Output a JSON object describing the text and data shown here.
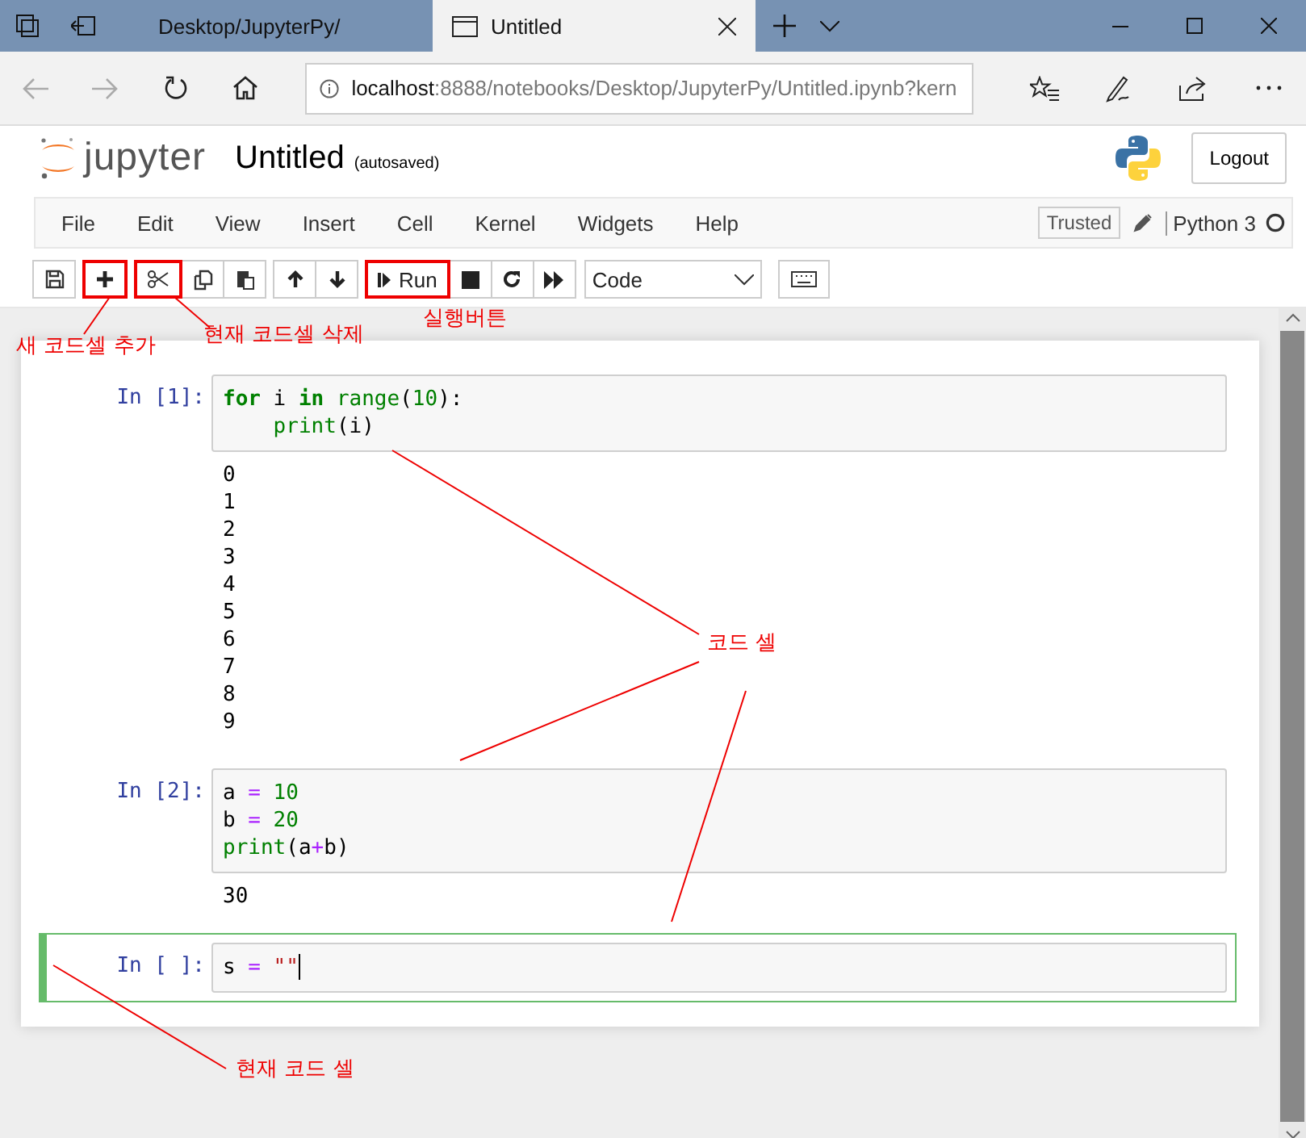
{
  "browser": {
    "tabs": [
      {
        "title": "Desktop/JupyterPy/",
        "selected": false
      },
      {
        "title": "Untitled",
        "selected": true
      }
    ],
    "nav": {
      "back_enabled": false,
      "forward_enabled": false
    },
    "address": {
      "host": "localhost",
      "path": ":8888/notebooks/Desktop/JupyterPy/Untitled.ipynb?kern"
    }
  },
  "header": {
    "logo_text": "jupyter",
    "title": "Untitled",
    "save_status": "(autosaved)",
    "logout": "Logout"
  },
  "menubar": {
    "items": [
      "File",
      "Edit",
      "View",
      "Insert",
      "Cell",
      "Kernel",
      "Widgets",
      "Help"
    ],
    "trusted": "Trusted",
    "kernel": "Python 3",
    "kernel_busy": false
  },
  "toolbar": {
    "groups": [
      [
        {
          "highlighted": false
        }
      ],
      [
        {
          "highlighted": true
        }
      ],
      [
        {
          "highlighted": true
        },
        {
          "highlighted": false
        },
        {
          "highlighted": false
        }
      ],
      [
        {
          "highlighted": false
        },
        {
          "highlighted": false
        }
      ],
      [
        {
          "highlighted": true,
          "label": "Run"
        },
        {
          "highlighted": false
        },
        {
          "highlighted": false
        },
        {
          "highlighted": false
        }
      ]
    ],
    "cell_type": "Code"
  },
  "cells": [
    {
      "prompt": "In [1]:",
      "selected": false,
      "lines": [
        [
          {
            "kind": "kw",
            "text": "for"
          },
          {
            "kind": "text",
            "text": " i "
          },
          {
            "kind": "kw",
            "text": "in"
          },
          {
            "kind": "builtin",
            "text": " range"
          },
          {
            "kind": "text",
            "text": "("
          },
          {
            "kind": "num",
            "text": "10"
          },
          {
            "kind": "text",
            "text": "):"
          }
        ],
        [
          {
            "kind": "builtin",
            "text": "    print"
          },
          {
            "kind": "text",
            "text": "(i)"
          }
        ]
      ],
      "outputs": [
        "0",
        "1",
        "2",
        "3",
        "4",
        "5",
        "6",
        "7",
        "8",
        "9"
      ]
    },
    {
      "prompt": "In [2]:",
      "selected": false,
      "lines": [
        [
          {
            "kind": "text",
            "text": "a "
          },
          {
            "kind": "op",
            "text": "="
          },
          {
            "kind": "num",
            "text": " 10"
          }
        ],
        [
          {
            "kind": "text",
            "text": "b "
          },
          {
            "kind": "op",
            "text": "="
          },
          {
            "kind": "num",
            "text": " 20"
          }
        ],
        [
          {
            "kind": "builtin",
            "text": "print"
          },
          {
            "kind": "text",
            "text": "(a"
          },
          {
            "kind": "op",
            "text": "+"
          },
          {
            "kind": "text",
            "text": "b)"
          }
        ]
      ],
      "outputs": [
        "30"
      ]
    },
    {
      "prompt": "In [ ]:",
      "selected": true,
      "lines": [
        [
          {
            "kind": "text",
            "text": "s "
          },
          {
            "kind": "op",
            "text": "="
          },
          {
            "kind": "str",
            "text": " \"\""
          }
        ]
      ]
    }
  ],
  "annotations": [
    {
      "text": "새 코드셀 추가"
    },
    {
      "text": "현재 코드셀 삭제"
    },
    {
      "text": "실행버튼"
    },
    {
      "text": "코드 셀"
    },
    {
      "text": "현재 코드 셀"
    }
  ]
}
